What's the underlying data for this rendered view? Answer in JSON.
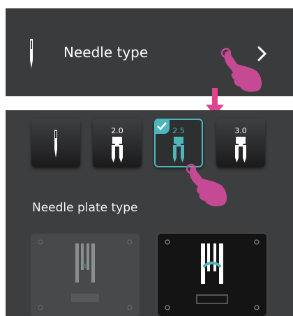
{
  "needle_row": {
    "label": "Needle type",
    "chevron": "chevron-right-icon",
    "leading_icon": "needle-icon"
  },
  "needle_options": [
    {
      "label": "",
      "icon": "single-needle-icon",
      "selected": false
    },
    {
      "label": "2.0",
      "icon": "twin-needle-icon",
      "selected": false
    },
    {
      "label": "2.5",
      "icon": "twin-needle-icon",
      "selected": true
    },
    {
      "label": "3.0",
      "icon": "twin-needle-icon",
      "selected": false
    }
  ],
  "needle_plate_section": {
    "label": "Needle plate type",
    "plates": [
      {
        "icon": "straight-stitch-plate-icon",
        "selected": false
      },
      {
        "icon": "zigzag-plate-icon",
        "selected": true
      }
    ]
  },
  "colors": {
    "accent": "#4db6ba",
    "arrow": "#e0448f",
    "hand": "#c64a93",
    "panel": "#3a3b3d"
  }
}
